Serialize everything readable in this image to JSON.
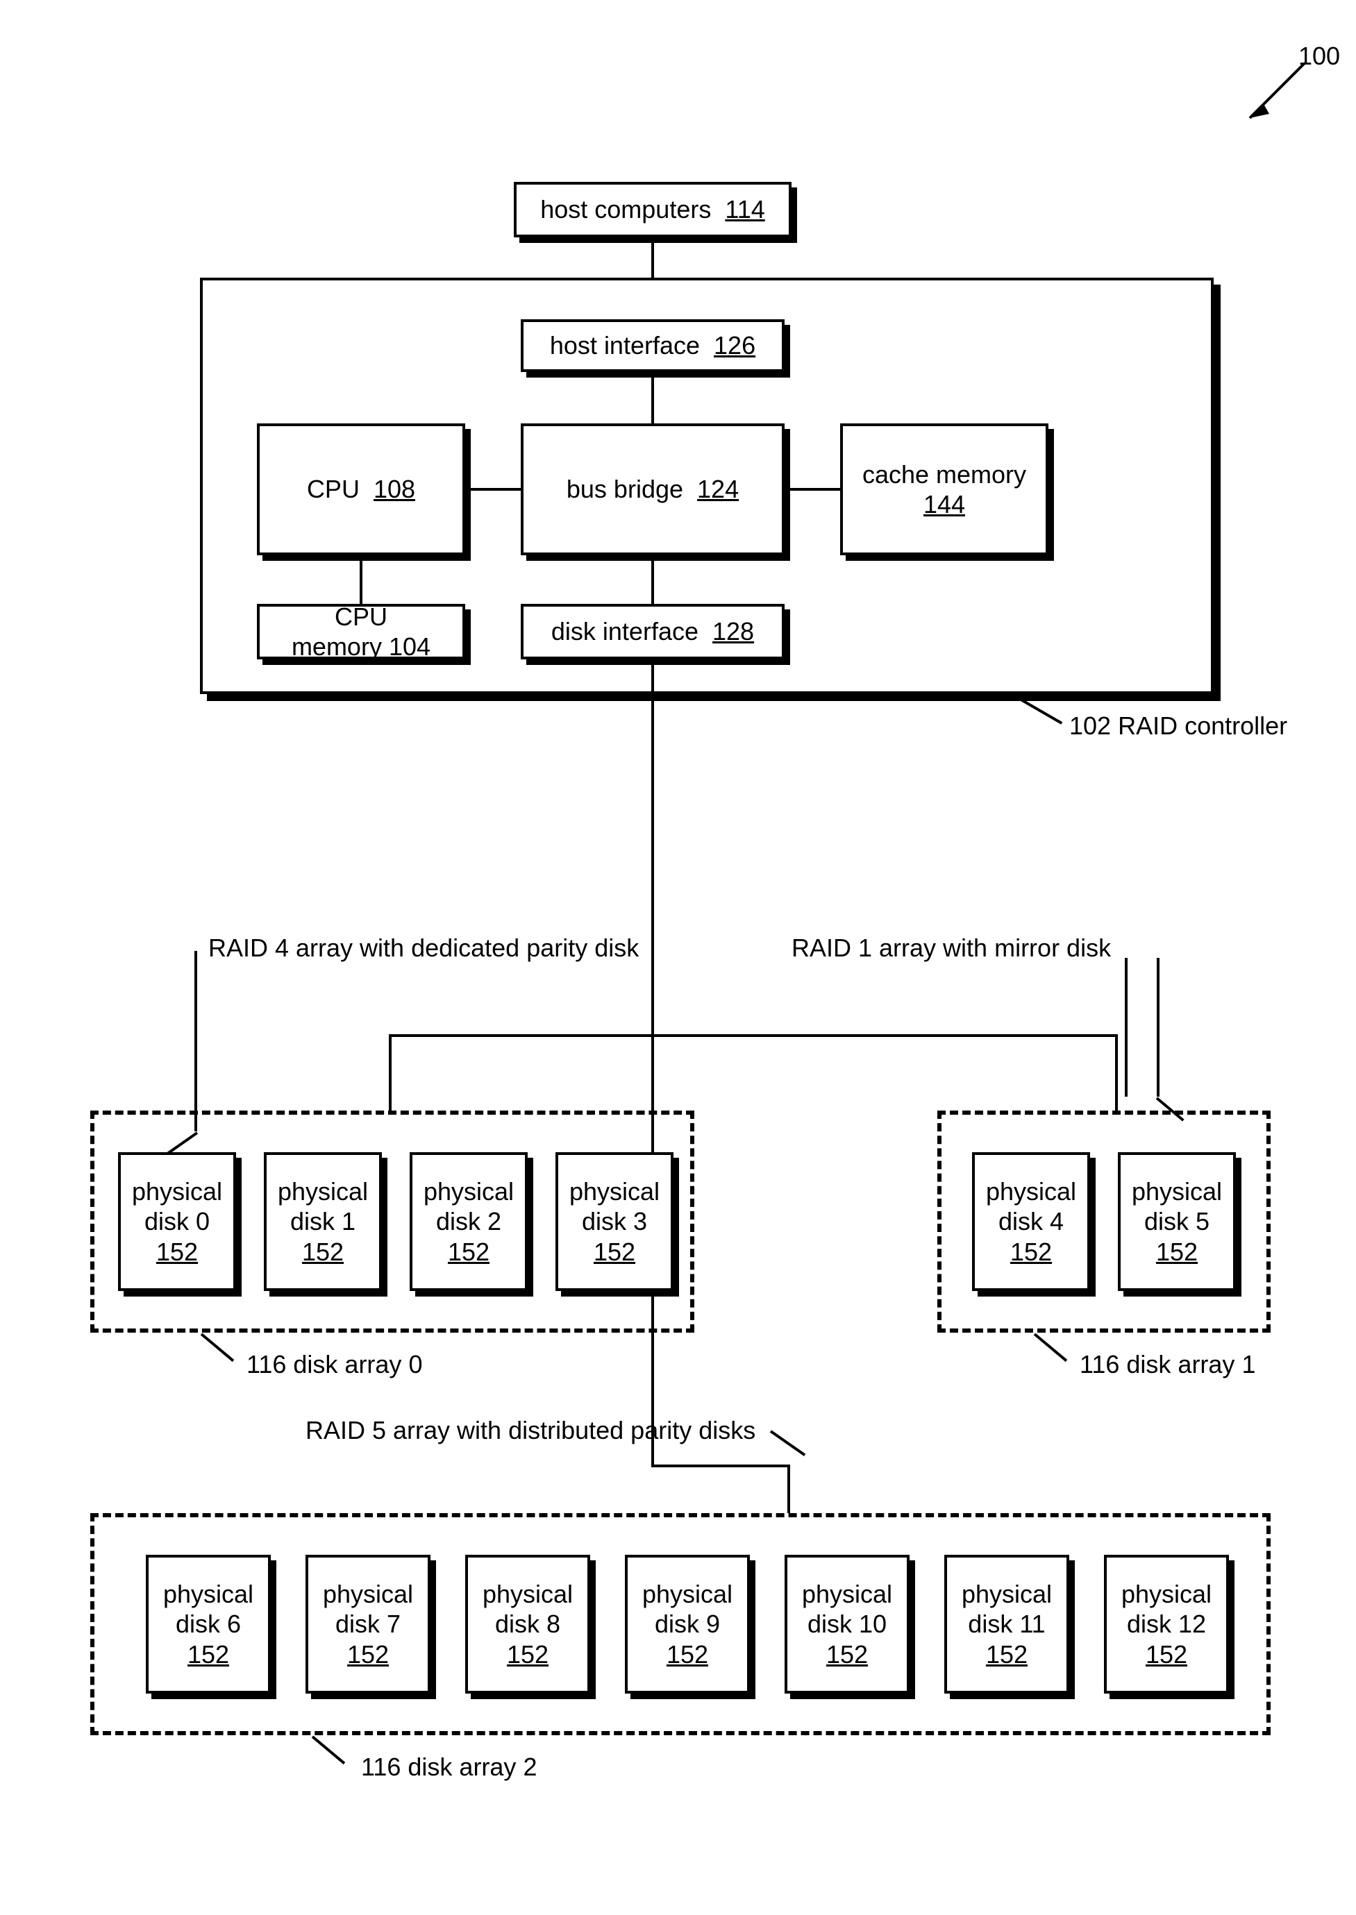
{
  "figure_ref": "100",
  "host_computers": {
    "label": "host computers",
    "ref": "114"
  },
  "controller_label": "102 RAID controller",
  "controller": {
    "host_interface": {
      "label": "host interface",
      "ref": "126"
    },
    "cpu": {
      "label": "CPU",
      "ref": "108"
    },
    "bus_bridge": {
      "label": "bus bridge",
      "ref": "124"
    },
    "cache_memory": {
      "label": "cache memory",
      "ref": "144"
    },
    "cpu_memory": {
      "label": "CPU memory",
      "ref": "104"
    },
    "disk_interface": {
      "label": "disk interface",
      "ref": "128"
    }
  },
  "array0": {
    "type_label": "RAID 4 array with dedicated parity disk",
    "caption": "116  disk array 0",
    "disks": [
      {
        "label": "physical disk 0",
        "ref": "152"
      },
      {
        "label": "physical disk 1",
        "ref": "152"
      },
      {
        "label": "physical disk 2",
        "ref": "152"
      },
      {
        "label": "physical disk 3",
        "ref": "152"
      }
    ]
  },
  "array1": {
    "type_label": "RAID 1 array with mirror disk",
    "caption": "116  disk array 1",
    "disks": [
      {
        "label": "physical disk 4",
        "ref": "152"
      },
      {
        "label": "physical disk 5",
        "ref": "152"
      }
    ]
  },
  "array2": {
    "type_label": "RAID 5 array with distributed parity disks",
    "caption": "116  disk array 2",
    "disks": [
      {
        "label": "physical disk 6",
        "ref": "152"
      },
      {
        "label": "physical disk 7",
        "ref": "152"
      },
      {
        "label": "physical disk 8",
        "ref": "152"
      },
      {
        "label": "physical disk 9",
        "ref": "152"
      },
      {
        "label": "physical disk 10",
        "ref": "152"
      },
      {
        "label": "physical disk 11",
        "ref": "152"
      },
      {
        "label": "physical disk 12",
        "ref": "152"
      }
    ]
  }
}
